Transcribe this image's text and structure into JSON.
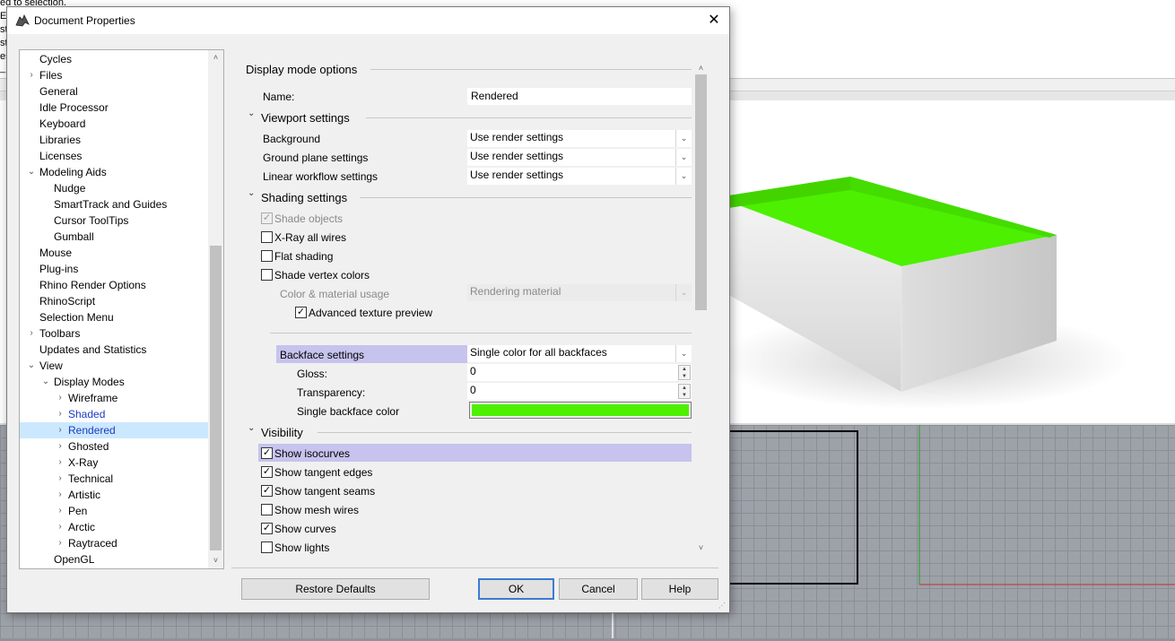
{
  "background_app": {
    "command_lines": [
      "ed to selection.",
      "E",
      "st",
      "st",
      "es",
      "_"
    ]
  },
  "dialog": {
    "title": "Document Properties",
    "close_glyph": "✕"
  },
  "tree": {
    "items": [
      {
        "label": "Cycles",
        "level": 0,
        "expander": "",
        "selected": false,
        "link": false
      },
      {
        "label": "Files",
        "level": 0,
        "expander": "›",
        "selected": false,
        "link": false
      },
      {
        "label": "General",
        "level": 0,
        "expander": "",
        "selected": false,
        "link": false
      },
      {
        "label": "Idle Processor",
        "level": 0,
        "expander": "",
        "selected": false,
        "link": false
      },
      {
        "label": "Keyboard",
        "level": 0,
        "expander": "",
        "selected": false,
        "link": false
      },
      {
        "label": "Libraries",
        "level": 0,
        "expander": "",
        "selected": false,
        "link": false
      },
      {
        "label": "Licenses",
        "level": 0,
        "expander": "",
        "selected": false,
        "link": false
      },
      {
        "label": "Modeling Aids",
        "level": 0,
        "expander": "⌄",
        "selected": false,
        "link": false
      },
      {
        "label": "Nudge",
        "level": 1,
        "expander": "",
        "selected": false,
        "link": false
      },
      {
        "label": "SmartTrack and Guides",
        "level": 1,
        "expander": "",
        "selected": false,
        "link": false
      },
      {
        "label": "Cursor ToolTips",
        "level": 1,
        "expander": "",
        "selected": false,
        "link": false
      },
      {
        "label": "Gumball",
        "level": 1,
        "expander": "",
        "selected": false,
        "link": false
      },
      {
        "label": "Mouse",
        "level": 0,
        "expander": "",
        "selected": false,
        "link": false
      },
      {
        "label": "Plug-ins",
        "level": 0,
        "expander": "",
        "selected": false,
        "link": false
      },
      {
        "label": "Rhino Render Options",
        "level": 0,
        "expander": "",
        "selected": false,
        "link": false
      },
      {
        "label": "RhinoScript",
        "level": 0,
        "expander": "",
        "selected": false,
        "link": false
      },
      {
        "label": "Selection Menu",
        "level": 0,
        "expander": "",
        "selected": false,
        "link": false
      },
      {
        "label": "Toolbars",
        "level": 0,
        "expander": "›",
        "selected": false,
        "link": false
      },
      {
        "label": "Updates and Statistics",
        "level": 0,
        "expander": "",
        "selected": false,
        "link": false
      },
      {
        "label": "View",
        "level": 0,
        "expander": "⌄",
        "selected": false,
        "link": false
      },
      {
        "label": "Display Modes",
        "level": 1,
        "expander": "⌄",
        "selected": false,
        "link": false
      },
      {
        "label": "Wireframe",
        "level": 2,
        "expander": "›",
        "selected": false,
        "link": false
      },
      {
        "label": "Shaded",
        "level": 2,
        "expander": "›",
        "selected": false,
        "link": true
      },
      {
        "label": "Rendered",
        "level": 2,
        "expander": "›",
        "selected": true,
        "link": true
      },
      {
        "label": "Ghosted",
        "level": 2,
        "expander": "›",
        "selected": false,
        "link": false
      },
      {
        "label": "X-Ray",
        "level": 2,
        "expander": "›",
        "selected": false,
        "link": false
      },
      {
        "label": "Technical",
        "level": 2,
        "expander": "›",
        "selected": false,
        "link": false
      },
      {
        "label": "Artistic",
        "level": 2,
        "expander": "›",
        "selected": false,
        "link": false
      },
      {
        "label": "Pen",
        "level": 2,
        "expander": "›",
        "selected": false,
        "link": false
      },
      {
        "label": "Arctic",
        "level": 2,
        "expander": "›",
        "selected": false,
        "link": false
      },
      {
        "label": "Raytraced",
        "level": 2,
        "expander": "›",
        "selected": false,
        "link": false
      },
      {
        "label": "OpenGL",
        "level": 1,
        "expander": "",
        "selected": false,
        "link": false
      }
    ]
  },
  "content": {
    "display_mode_options": {
      "heading": "Display mode options",
      "name_label": "Name:",
      "name_value": "Rendered"
    },
    "viewport_settings": {
      "heading": "Viewport settings",
      "background_label": "Background",
      "background_value": "Use render settings",
      "ground_plane_label": "Ground plane settings",
      "ground_plane_value": "Use render settings",
      "linear_workflow_label": "Linear workflow settings",
      "linear_workflow_value": "Use render settings"
    },
    "shading_settings": {
      "heading": "Shading settings",
      "shade_objects": {
        "label": "Shade objects",
        "checked": true,
        "disabled": true
      },
      "xray_all_wires": {
        "label": "X-Ray all wires",
        "checked": false
      },
      "flat_shading": {
        "label": "Flat shading",
        "checked": false
      },
      "shade_vertex_colors": {
        "label": "Shade vertex colors",
        "checked": false
      },
      "color_material_label": "Color & material usage",
      "color_material_value": "Rendering material",
      "advanced_texture_preview": {
        "label": "Advanced texture preview",
        "checked": true
      },
      "backface_label": "Backface settings",
      "backface_value": "Single color for all backfaces",
      "gloss_label": "Gloss:",
      "gloss_value": "0",
      "transparency_label": "Transparency:",
      "transparency_value": "0",
      "backface_color_label": "Single backface color",
      "backface_color": "#4cf000"
    },
    "visibility": {
      "heading": "Visibility",
      "items": [
        {
          "label": "Show isocurves",
          "checked": true,
          "highlighted": true
        },
        {
          "label": "Show tangent edges",
          "checked": true,
          "highlighted": false
        },
        {
          "label": "Show tangent seams",
          "checked": true,
          "highlighted": false
        },
        {
          "label": "Show mesh wires",
          "checked": false,
          "highlighted": false
        },
        {
          "label": "Show curves",
          "checked": true,
          "highlighted": false
        },
        {
          "label": "Show lights",
          "checked": false,
          "highlighted": false
        }
      ]
    }
  },
  "buttons": {
    "restore_defaults": "Restore Defaults",
    "ok": "OK",
    "cancel": "Cancel",
    "help": "Help"
  },
  "glyphs": {
    "check": "✓",
    "dropdown": "⌄",
    "scroll_up": "˄",
    "scroll_down": "˅",
    "spin_up": "▲",
    "spin_down": "▼",
    "collapse": "⌄"
  },
  "colors": {
    "selection_highlight": "#cce8ff",
    "row_highlight": "#c6c3ee",
    "box_inner": "#4cf000"
  }
}
